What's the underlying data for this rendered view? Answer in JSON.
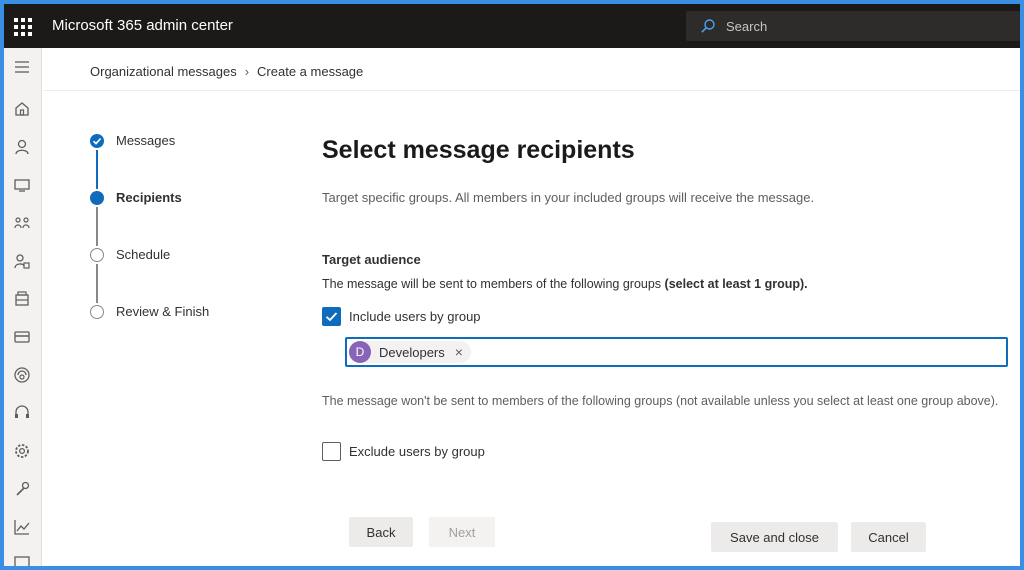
{
  "header": {
    "app_title": "Microsoft 365 admin center",
    "search_placeholder": "Search"
  },
  "nav_rail": {
    "icons": [
      "hamburger-menu-icon",
      "home-icon",
      "user-icon",
      "devices-icon",
      "teams-icon",
      "roles-icon",
      "resources-icon",
      "billing-icon",
      "exchange-icon",
      "support-icon",
      "settings-icon",
      "setup-icon",
      "reports-icon",
      "health-icon"
    ]
  },
  "breadcrumb": {
    "parent": "Organizational messages",
    "current": "Create a message"
  },
  "steps": [
    {
      "label": "Messages",
      "state": "done"
    },
    {
      "label": "Recipients",
      "state": "current"
    },
    {
      "label": "Schedule",
      "state": "todo"
    },
    {
      "label": "Review & Finish",
      "state": "todo"
    }
  ],
  "main": {
    "title": "Select message recipients",
    "subtitle": "Target specific groups. All members in your included groups will receive the message.",
    "target_heading": "Target audience",
    "target_desc": "The message will be sent to members of the following groups",
    "target_desc_bold": "(select at least 1 group).",
    "include_label": "Include users by group",
    "include_checked": true,
    "selected_group": {
      "initial": "D",
      "name": "Developers",
      "remove": "×"
    },
    "exclude_note": "The message won't be sent to members of the following groups (not available unless you select at least one group above).",
    "exclude_label": "Exclude users by group",
    "exclude_checked": false
  },
  "footer": {
    "back": "Back",
    "next": "Next",
    "save_close": "Save and close",
    "cancel": "Cancel"
  },
  "colors": {
    "accent": "#0f6cbd",
    "topbar": "#1b1a19",
    "chip_avatar": "#8764b8"
  }
}
